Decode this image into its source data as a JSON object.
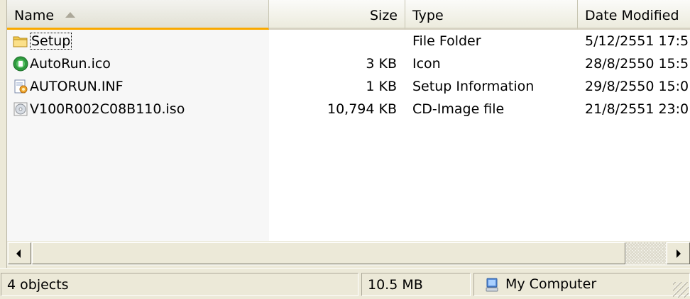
{
  "columns": {
    "name": "Name",
    "size": "Size",
    "type": "Type",
    "date": "Date Modified"
  },
  "files": [
    {
      "name": "Setup",
      "size": "",
      "type": "File Folder",
      "date": "5/12/2551 17:5",
      "icon": "folder-icon"
    },
    {
      "name": "AutoRun.ico",
      "size": "3 KB",
      "type": "Icon",
      "date": "28/8/2550 15:5",
      "icon": "app-icon"
    },
    {
      "name": "AUTORUN.INF",
      "size": "1 KB",
      "type": "Setup Information",
      "date": "29/8/2550 15:0",
      "icon": "setup-info-icon"
    },
    {
      "name": "V100R002C08B110.iso",
      "size": "10,794 KB",
      "type": "CD-Image file",
      "date": "21/8/2551 23:0",
      "icon": "disc-image-icon"
    }
  ],
  "status": {
    "objects": "4 objects",
    "size": "10.5 MB",
    "location": "My Computer"
  },
  "colors": {
    "window_bg": "#ece9d8",
    "sort_highlight": "#f9a900"
  }
}
